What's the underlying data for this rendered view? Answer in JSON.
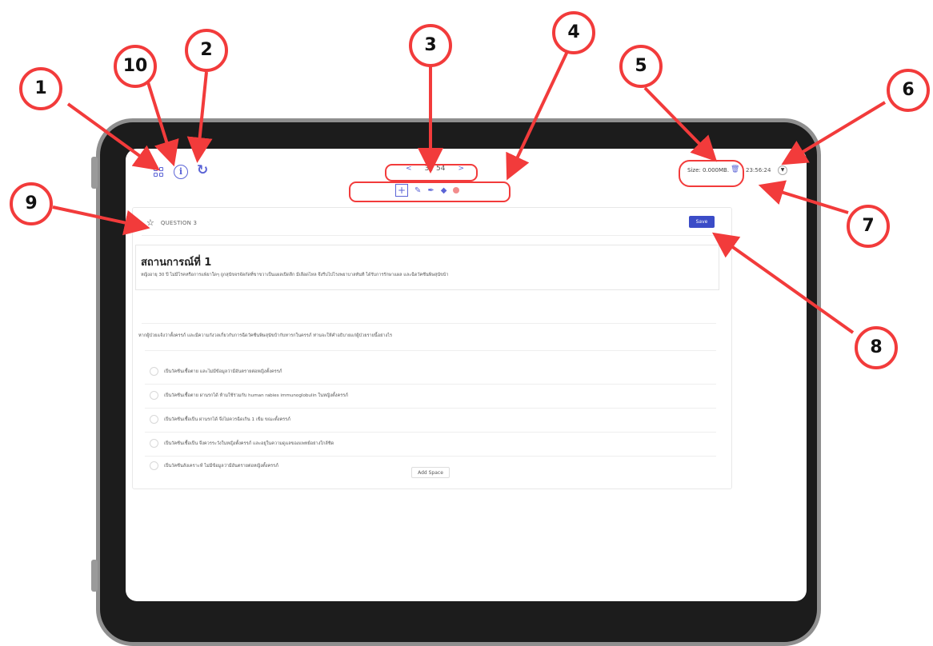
{
  "toolbar": {
    "pager_prev": "<",
    "pager_text": "3 / 54",
    "pager_next": ">",
    "size_label": "Size: 0.000MB.",
    "timer": "23:56:24"
  },
  "icons": {
    "menu": "grid-icon",
    "info": "info-icon",
    "refresh": "refresh-icon",
    "trash": "trash-icon",
    "dropdown": "chevron-down-icon",
    "tools": [
      "move-icon",
      "pen-icon",
      "highlighter-icon",
      "eraser-icon",
      "color-dot-icon"
    ]
  },
  "question": {
    "label": "QUESTION 3",
    "save_label": "Save",
    "scenario_title": "สถานการณ์ที่ 1",
    "scenario_body": "หญิงอายุ 30 ปี ไม่มีโรคหรือการแพ้ยาใดๆ ถูกสุนัขจรจัดกัดที่ขาขวาเป็นแผลเปิดลึก มีเลือดไหล จึงรีบไปโรงพยาบาลทันที ได้รับการรักษาแผล และฉีดวัคซีนพิษสุนัขบ้า",
    "prompt": "หากผู้ป่วยแจ้งว่าตั้งครรภ์ และมีความกังวลเกี่ยวกับการฉีดวัคซีนพิษสุนัขบ้ากับทารกในครรภ์ ท่านจะให้คำอธิบายแก่ผู้ป่วยรายนี้อย่างไร",
    "options": [
      "เป็นวัคซีนเชื้อตาย และไม่มีข้อมูลว่ามีอันตรายต่อหญิงตั้งครรภ์",
      "เป็นวัคซีนเชื้อตาย ผ่านรกได้ ห้ามใช้ร่วมกับ human rabies immunoglobulin ในหญิงตั้งครรภ์",
      "เป็นวัคซีนเชื้อเป็น ผ่านรกได้ จึงไม่ควรฉีดเกิน 1 เข็ม ขณะตั้งครรภ์",
      "เป็นวัคซีนเชื้อเป็น จึงควรระวังในหญิงตั้งครรภ์ และอยู่ในความดูแลของแพทย์อย่างใกล้ชิด",
      "เป็นวัคซีนสังเคราะห์ ไม่มีข้อมูลว่ามีอันตรายต่อหญิงตั้งครรภ์"
    ],
    "add_space_label": "Add Space"
  },
  "annotations": {
    "numbers": [
      "1",
      "2",
      "3",
      "4",
      "5",
      "6",
      "7",
      "8",
      "9",
      "10"
    ],
    "color": "#f23b3b"
  },
  "colors": {
    "accent": "#5b64d6",
    "save_button": "#3b4cc7",
    "frame": "#1c1c1c"
  }
}
